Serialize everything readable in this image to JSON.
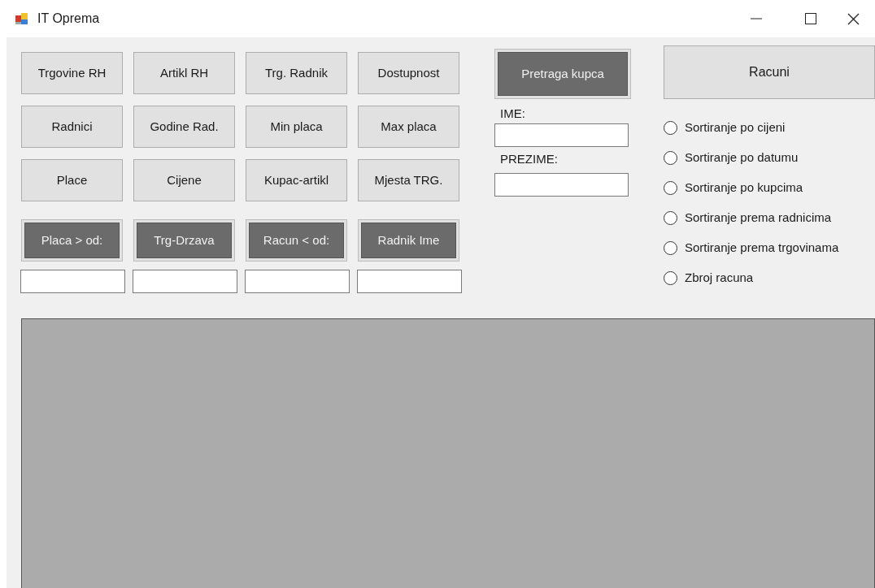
{
  "window": {
    "title": "IT Oprema"
  },
  "query_buttons": [
    {
      "label": "Trgovine RH",
      "kind": "plain"
    },
    {
      "label": "Artikl RH",
      "kind": "plain"
    },
    {
      "label": "Trg. Radnik",
      "kind": "plain"
    },
    {
      "label": "Dostupnost",
      "kind": "plain"
    },
    {
      "label": "Radnici",
      "kind": "plain"
    },
    {
      "label": "Godine Rad.",
      "kind": "plain"
    },
    {
      "label": "Min placa",
      "kind": "plain"
    },
    {
      "label": "Max placa",
      "kind": "plain"
    },
    {
      "label": "Place",
      "kind": "plain"
    },
    {
      "label": "Cijene",
      "kind": "plain"
    },
    {
      "label": "Kupac-artikl",
      "kind": "plain"
    },
    {
      "label": "Mjesta TRG.",
      "kind": "plain"
    }
  ],
  "filter_buttons": [
    {
      "label": "Placa > od:",
      "kind": "dark"
    },
    {
      "label": "Trg-Drzava",
      "kind": "dark"
    },
    {
      "label": "Racun < od:",
      "kind": "dark"
    },
    {
      "label": "Radnik Ime",
      "kind": "dark"
    }
  ],
  "customer_search": {
    "button": {
      "label": "Pretraga kupca",
      "kind": "dark"
    },
    "fields": [
      {
        "label": "IME:"
      },
      {
        "label": "PREZIME:"
      }
    ]
  },
  "invoices_button": {
    "label": "Racuni",
    "kind": "plain"
  },
  "sort_options": [
    {
      "label": "Sortiranje po cijeni",
      "selected": false
    },
    {
      "label": "Sortiranje po datumu",
      "selected": false
    },
    {
      "label": "Sortiranje po kupcima",
      "selected": false
    },
    {
      "label": "Sortiranje prema radnicima",
      "selected": false
    },
    {
      "label": "Sortiranje prema trgovinama",
      "selected": false
    },
    {
      "label": "Zbroj racuna",
      "selected": false
    }
  ]
}
